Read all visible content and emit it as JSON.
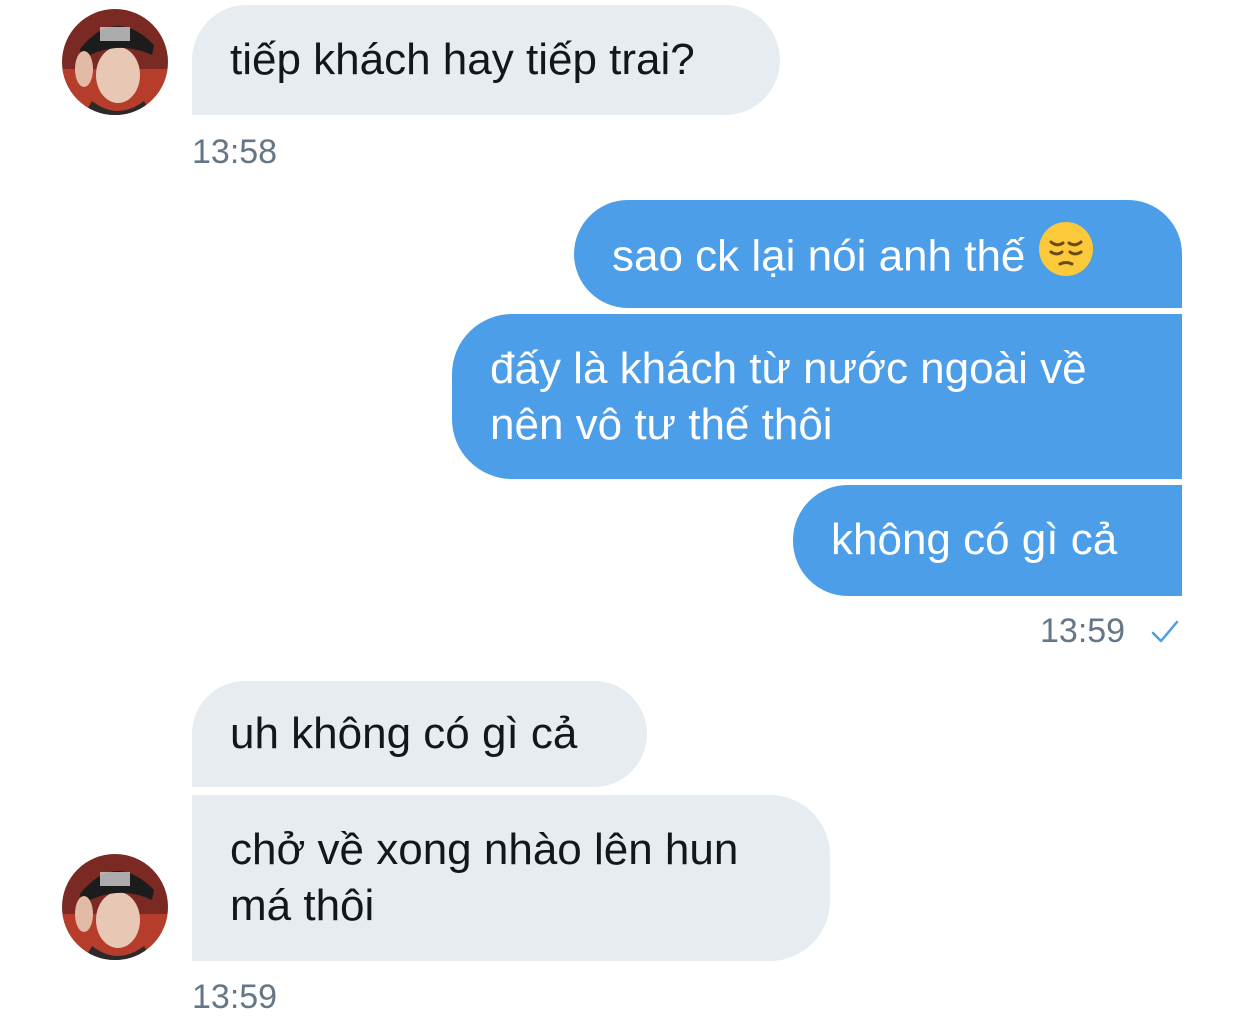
{
  "conversation": {
    "messages": [
      {
        "id": "m1",
        "direction": "incoming",
        "text": "tiếp khách hay tiếp trai?"
      },
      {
        "id": "m2",
        "direction": "outgoing",
        "text": "sao ck lại nói anh thế",
        "emoji": "pensive-face"
      },
      {
        "id": "m3",
        "direction": "outgoing",
        "lines": [
          "đấy là khách từ nước ngoài về",
          "nên vô tư thế thôi"
        ]
      },
      {
        "id": "m4",
        "direction": "outgoing",
        "text": "không có gì cả"
      },
      {
        "id": "m5",
        "direction": "incoming",
        "text": "uh không có gì cả"
      },
      {
        "id": "m6",
        "direction": "incoming",
        "lines": [
          "chở về xong nhào lên hun",
          "má thôi"
        ]
      }
    ],
    "timestamps": {
      "t1": "13:58",
      "t2": "13:59",
      "t3": "13:59"
    },
    "read_receipt_icon": "check-icon"
  },
  "colors": {
    "incoming_bubble": "#e6ecf0",
    "outgoing_bubble": "#4c9ee9",
    "timestamp": "#657786",
    "check": "#4c9ee9"
  }
}
